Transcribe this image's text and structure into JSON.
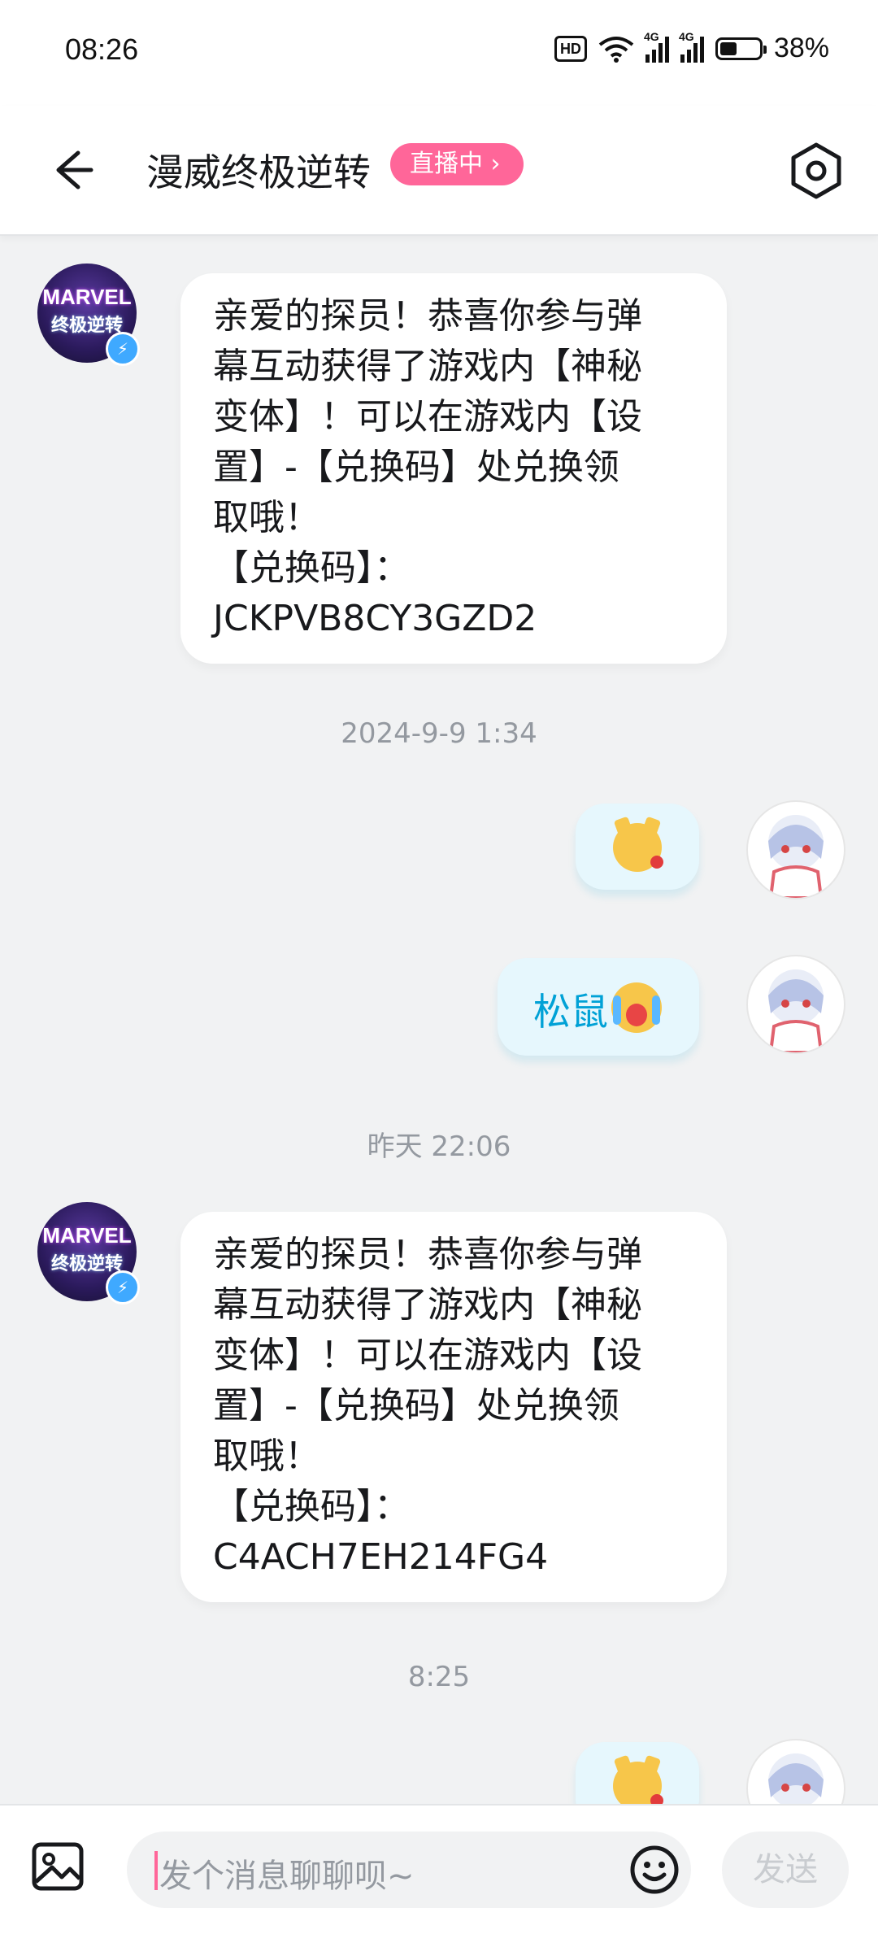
{
  "status_bar": {
    "time": "08:26",
    "network_badge": "HD",
    "signal_label": "4G",
    "battery": "38%"
  },
  "header": {
    "title": "漫威终极逆转",
    "live_badge": "直播中 ›",
    "back_icon": "arrow-left-icon",
    "settings_icon": "hexagon-gear-icon"
  },
  "messages": [
    {
      "sender": "official",
      "avatar_text": [
        "MARVEL",
        "终极逆转"
      ],
      "text": "亲爱的探员！恭喜你参与弹\n幕互动获得了游戏内【神秘\n变体】！可以在游戏内【设\n置】-【兑换码】处兑换领\n取哦！\n【兑换码】：\nJCKPVB8CY3GZD2"
    },
    {
      "time_divider": "2024-9-9 1:34"
    },
    {
      "sender": "me",
      "sticker": "dog-with-rose-emoji"
    },
    {
      "sender": "me",
      "text": "松鼠",
      "sticker": "crying-emoji"
    },
    {
      "time_divider": "昨天 22:06"
    },
    {
      "sender": "official",
      "avatar_text": [
        "MARVEL",
        "终极逆转"
      ],
      "text": "亲爱的探员！恭喜你参与弹\n幕互动获得了游戏内【神秘\n变体】！可以在游戏内【设\n置】-【兑换码】处兑换领\n取哦！\n【兑换码】：\nC4ACH7EH214FG4"
    },
    {
      "time_divider": "8:25"
    },
    {
      "sender": "me",
      "sticker": "dog-with-rose-emoji"
    }
  ],
  "composer": {
    "placeholder": "发个消息聊聊呗~",
    "send_label": "发送",
    "image_icon": "image-icon",
    "emoji_icon": "smiley-icon"
  },
  "colors": {
    "accent": "#ff6699",
    "bubble_mine": "#e6f7fd",
    "bubble_text_mine": "#00a1d6",
    "background": "#f1f2f3"
  }
}
